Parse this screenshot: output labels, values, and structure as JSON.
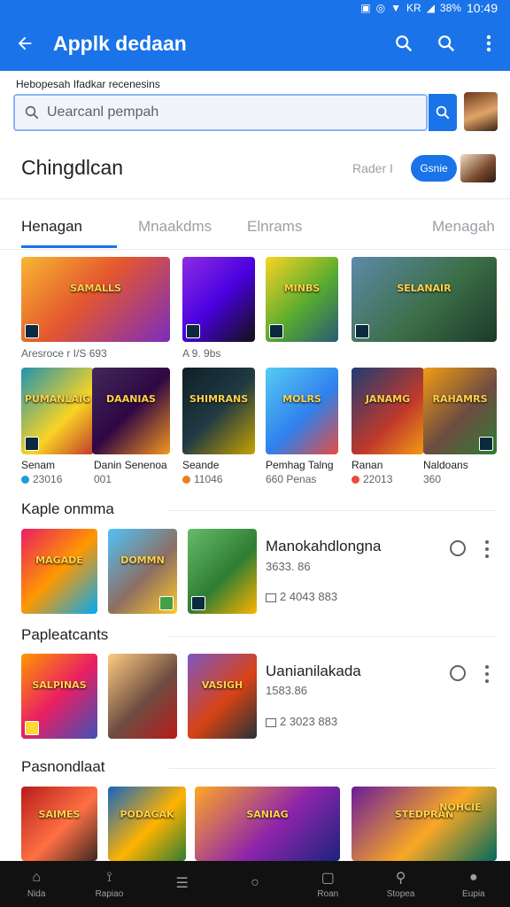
{
  "status": {
    "icons": [
      "nfc-icon",
      "alarm-icon",
      "wifi-icon",
      "signal-icon"
    ],
    "network": "KR",
    "battery": "38%",
    "time": "10:49"
  },
  "appbar": {
    "title": "Applk dedaan",
    "accent": "#1a73e8"
  },
  "search": {
    "hint": "Hebopesah Ifadkar recenesins",
    "placeholder": "Uearcanl pempah"
  },
  "section": {
    "title": "Chingdlcan",
    "meta": "Rader I",
    "pill": "Gsnie"
  },
  "tabs": [
    {
      "label": "Henagan"
    },
    {
      "label": "Mnaakdms"
    },
    {
      "label": "Elnrams"
    },
    {
      "label": "Menagah"
    }
  ],
  "grid_row1": {
    "cap1": "Aresroce r I/S 693",
    "cap2": "A 9. 9bs"
  },
  "grid_row2": [
    {
      "title": "Senam",
      "sub": "23016"
    },
    {
      "title": "Danin Senenoa",
      "sub": "001"
    },
    {
      "title": "Seande",
      "sub": "11046"
    },
    {
      "title": "Pemhag Talng",
      "sub": "660 Penas"
    },
    {
      "title": "Ranan",
      "sub": "22013"
    },
    {
      "title": "Naldoans",
      "sub": "360"
    }
  ],
  "lists": [
    {
      "heading": "Kaple onmma",
      "title": "Manokahdlongna",
      "meta1": "3633. 86",
      "meta2": "2 4043 883"
    },
    {
      "heading": "Papleatcants",
      "title": "Uanianilakada",
      "meta1": "1583.86",
      "meta2": "2 3023 883"
    }
  ],
  "last_heading": "Pasnondlaat",
  "tile_labels": {
    "t1": "SAMALLS",
    "t2": "",
    "t3": "MINBS",
    "t4": "SELANAIR",
    "t5": "PUMANLAIG",
    "t6": "DAANIAS",
    "t7": "SHIMRANS",
    "t8": "MOLRS",
    "t9": "JANAMG",
    "t10": "RAHAMRS",
    "t11": "MAGADE",
    "t12": "DOMMN",
    "t13": "",
    "t14": "SALPINAS",
    "t15": "",
    "t16": "VASIGH",
    "t17": "SAIMES",
    "t18": "PODAGAK",
    "t19": "SANIAG",
    "t20": "STEDPRAN",
    "t21": "NOHCIE"
  },
  "bottomnav": [
    {
      "label": "Nida",
      "icon": "home-icon"
    },
    {
      "label": "Rapiao",
      "icon": "apps-icon"
    },
    {
      "label": "",
      "icon": "menu-icon"
    },
    {
      "label": "",
      "icon": "circle-icon"
    },
    {
      "label": "Roan",
      "icon": "notification-icon"
    },
    {
      "label": "Stopea",
      "icon": "search-icon"
    },
    {
      "label": "Eupia",
      "icon": "person-icon"
    }
  ]
}
